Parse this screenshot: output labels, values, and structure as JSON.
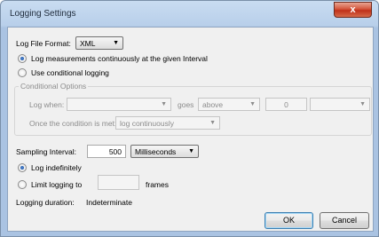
{
  "window": {
    "title": "Logging Settings",
    "close_glyph": "x"
  },
  "log_file_format": {
    "label": "Log File Format:",
    "value": "XML"
  },
  "logging_mode": {
    "option_continuous": "Log measurements continuously at the given Interval",
    "option_conditional": "Use conditional logging",
    "selected": "continuous"
  },
  "conditional_options": {
    "title": "Conditional Options",
    "log_when_label": "Log when:",
    "log_when_value": "",
    "goes_label": "goes",
    "goes_value": "above",
    "threshold_value": "0",
    "unit_value": "",
    "once_met_label": "Once the condition is met:",
    "once_met_value": "log continuously"
  },
  "sampling": {
    "label": "Sampling Interval:",
    "value": "500",
    "unit": "Milliseconds"
  },
  "duration_mode": {
    "option_indefinite": "Log indefinitely",
    "option_limit": "Limit logging to",
    "limit_value": "",
    "limit_unit": "frames",
    "selected": "indefinite"
  },
  "logging_duration": {
    "label": "Logging duration:",
    "value": "Indeterminate"
  },
  "buttons": {
    "ok": "OK",
    "cancel": "Cancel"
  }
}
